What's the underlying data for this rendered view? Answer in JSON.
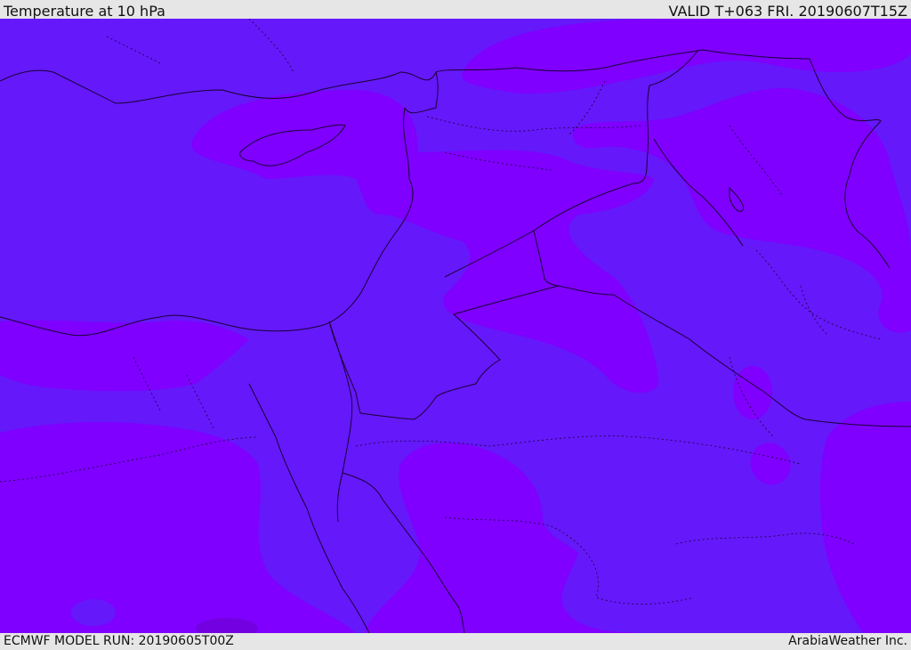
{
  "header": {
    "title": "Temperature at 10 hPa",
    "valid_time": "VALID T+063 FRI. 20190607T15Z"
  },
  "footer": {
    "model_run": "ECMWF MODEL RUN: 20190605T00Z",
    "credit": "ArabiaWeather Inc."
  },
  "map": {
    "colors": {
      "base_shade": "#6518fa",
      "warm_shade": "#7f00ff",
      "warmest_shade": "#7300e0",
      "border_line": "#1a0033",
      "background": "#e6e6e6"
    }
  }
}
